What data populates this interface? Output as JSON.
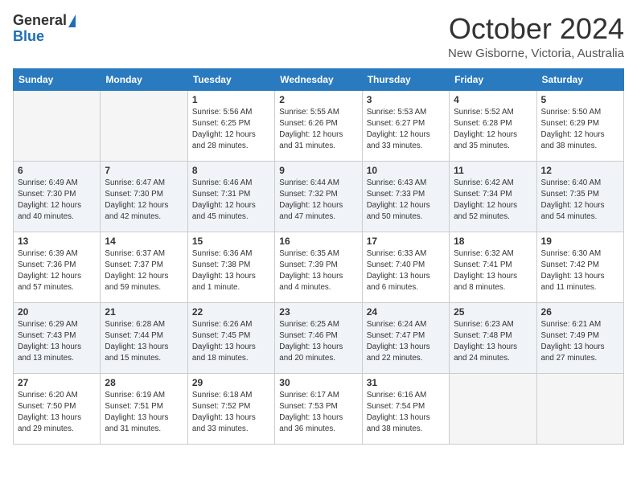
{
  "header": {
    "logo_general": "General",
    "logo_blue": "Blue",
    "month": "October 2024",
    "location": "New Gisborne, Victoria, Australia"
  },
  "days_of_week": [
    "Sunday",
    "Monday",
    "Tuesday",
    "Wednesday",
    "Thursday",
    "Friday",
    "Saturday"
  ],
  "weeks": [
    [
      {
        "day": "",
        "info": ""
      },
      {
        "day": "",
        "info": ""
      },
      {
        "day": "1",
        "info": "Sunrise: 5:56 AM\nSunset: 6:25 PM\nDaylight: 12 hours\nand 28 minutes."
      },
      {
        "day": "2",
        "info": "Sunrise: 5:55 AM\nSunset: 6:26 PM\nDaylight: 12 hours\nand 31 minutes."
      },
      {
        "day": "3",
        "info": "Sunrise: 5:53 AM\nSunset: 6:27 PM\nDaylight: 12 hours\nand 33 minutes."
      },
      {
        "day": "4",
        "info": "Sunrise: 5:52 AM\nSunset: 6:28 PM\nDaylight: 12 hours\nand 35 minutes."
      },
      {
        "day": "5",
        "info": "Sunrise: 5:50 AM\nSunset: 6:29 PM\nDaylight: 12 hours\nand 38 minutes."
      }
    ],
    [
      {
        "day": "6",
        "info": "Sunrise: 6:49 AM\nSunset: 7:30 PM\nDaylight: 12 hours\nand 40 minutes."
      },
      {
        "day": "7",
        "info": "Sunrise: 6:47 AM\nSunset: 7:30 PM\nDaylight: 12 hours\nand 42 minutes."
      },
      {
        "day": "8",
        "info": "Sunrise: 6:46 AM\nSunset: 7:31 PM\nDaylight: 12 hours\nand 45 minutes."
      },
      {
        "day": "9",
        "info": "Sunrise: 6:44 AM\nSunset: 7:32 PM\nDaylight: 12 hours\nand 47 minutes."
      },
      {
        "day": "10",
        "info": "Sunrise: 6:43 AM\nSunset: 7:33 PM\nDaylight: 12 hours\nand 50 minutes."
      },
      {
        "day": "11",
        "info": "Sunrise: 6:42 AM\nSunset: 7:34 PM\nDaylight: 12 hours\nand 52 minutes."
      },
      {
        "day": "12",
        "info": "Sunrise: 6:40 AM\nSunset: 7:35 PM\nDaylight: 12 hours\nand 54 minutes."
      }
    ],
    [
      {
        "day": "13",
        "info": "Sunrise: 6:39 AM\nSunset: 7:36 PM\nDaylight: 12 hours\nand 57 minutes."
      },
      {
        "day": "14",
        "info": "Sunrise: 6:37 AM\nSunset: 7:37 PM\nDaylight: 12 hours\nand 59 minutes."
      },
      {
        "day": "15",
        "info": "Sunrise: 6:36 AM\nSunset: 7:38 PM\nDaylight: 13 hours\nand 1 minute."
      },
      {
        "day": "16",
        "info": "Sunrise: 6:35 AM\nSunset: 7:39 PM\nDaylight: 13 hours\nand 4 minutes."
      },
      {
        "day": "17",
        "info": "Sunrise: 6:33 AM\nSunset: 7:40 PM\nDaylight: 13 hours\nand 6 minutes."
      },
      {
        "day": "18",
        "info": "Sunrise: 6:32 AM\nSunset: 7:41 PM\nDaylight: 13 hours\nand 8 minutes."
      },
      {
        "day": "19",
        "info": "Sunrise: 6:30 AM\nSunset: 7:42 PM\nDaylight: 13 hours\nand 11 minutes."
      }
    ],
    [
      {
        "day": "20",
        "info": "Sunrise: 6:29 AM\nSunset: 7:43 PM\nDaylight: 13 hours\nand 13 minutes."
      },
      {
        "day": "21",
        "info": "Sunrise: 6:28 AM\nSunset: 7:44 PM\nDaylight: 13 hours\nand 15 minutes."
      },
      {
        "day": "22",
        "info": "Sunrise: 6:26 AM\nSunset: 7:45 PM\nDaylight: 13 hours\nand 18 minutes."
      },
      {
        "day": "23",
        "info": "Sunrise: 6:25 AM\nSunset: 7:46 PM\nDaylight: 13 hours\nand 20 minutes."
      },
      {
        "day": "24",
        "info": "Sunrise: 6:24 AM\nSunset: 7:47 PM\nDaylight: 13 hours\nand 22 minutes."
      },
      {
        "day": "25",
        "info": "Sunrise: 6:23 AM\nSunset: 7:48 PM\nDaylight: 13 hours\nand 24 minutes."
      },
      {
        "day": "26",
        "info": "Sunrise: 6:21 AM\nSunset: 7:49 PM\nDaylight: 13 hours\nand 27 minutes."
      }
    ],
    [
      {
        "day": "27",
        "info": "Sunrise: 6:20 AM\nSunset: 7:50 PM\nDaylight: 13 hours\nand 29 minutes."
      },
      {
        "day": "28",
        "info": "Sunrise: 6:19 AM\nSunset: 7:51 PM\nDaylight: 13 hours\nand 31 minutes."
      },
      {
        "day": "29",
        "info": "Sunrise: 6:18 AM\nSunset: 7:52 PM\nDaylight: 13 hours\nand 33 minutes."
      },
      {
        "day": "30",
        "info": "Sunrise: 6:17 AM\nSunset: 7:53 PM\nDaylight: 13 hours\nand 36 minutes."
      },
      {
        "day": "31",
        "info": "Sunrise: 6:16 AM\nSunset: 7:54 PM\nDaylight: 13 hours\nand 38 minutes."
      },
      {
        "day": "",
        "info": ""
      },
      {
        "day": "",
        "info": ""
      }
    ]
  ]
}
